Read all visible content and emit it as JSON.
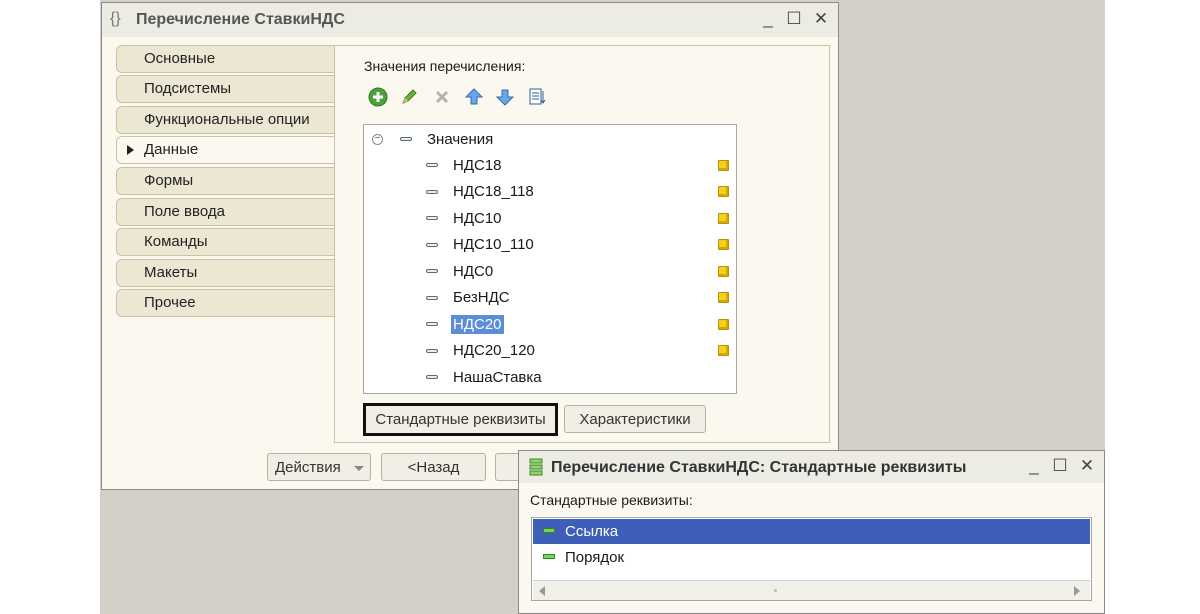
{
  "main_window": {
    "title": "Перечисление СтавкиНДС",
    "tabs": [
      "Основные",
      "Подсистемы",
      "Функциональные опции",
      "Данные",
      "Формы",
      "Поле ввода",
      "Команды",
      "Макеты",
      "Прочее"
    ],
    "active_tab": "Данные",
    "section_label": "Значения перечисления:",
    "tree": {
      "root": "Значения",
      "items": [
        "НДС18",
        "НДС18_118",
        "НДС10",
        "НДС10_110",
        "НДС0",
        "БезНДС",
        "НДС20",
        "НДС20_120",
        "НашаСтавка"
      ],
      "selected": "НДС20"
    },
    "buttons": {
      "standard_attrs": "Стандартные реквизиты",
      "characteristics": "Характеристики",
      "actions": "Действия",
      "back": "<Назад"
    }
  },
  "dialog": {
    "title": "Перечисление СтавкиНДС: Стандартные реквизиты",
    "label": "Стандартные реквизиты:",
    "items": [
      "Ссылка",
      "Порядок"
    ],
    "selected": "Ссылка"
  },
  "colors": {
    "selection": "#5b8ed6",
    "dialog_selection": "#3d5fb8",
    "window_bg": "#fbf9ef",
    "workspace": "#d4d0c8"
  }
}
